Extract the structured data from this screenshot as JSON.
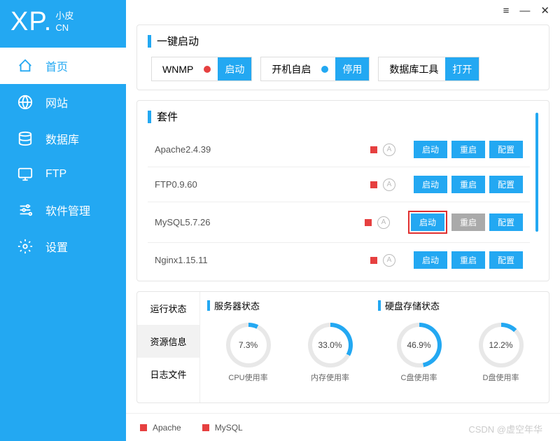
{
  "logo": {
    "main": "XP.",
    "sub1": "小皮",
    "sub2": "CN"
  },
  "nav": [
    {
      "label": "首页",
      "icon": "home",
      "active": true
    },
    {
      "label": "网站",
      "icon": "globe",
      "active": false
    },
    {
      "label": "数据库",
      "icon": "database",
      "active": false
    },
    {
      "label": "FTP",
      "icon": "monitor",
      "active": false
    },
    {
      "label": "软件管理",
      "icon": "sliders",
      "active": false
    },
    {
      "label": "设置",
      "icon": "gear",
      "active": false
    }
  ],
  "titlebar": {
    "menu": "≡",
    "min": "—",
    "close": "✕"
  },
  "quickstart": {
    "title": "一键启动",
    "items": [
      {
        "label": "WNMP",
        "dot": "red",
        "btn": "启动"
      },
      {
        "label": "开机自启",
        "dot": "blue",
        "btn": "停用"
      },
      {
        "label": "数据库工具",
        "dot": "",
        "btn": "打开"
      }
    ]
  },
  "suite": {
    "title": "套件",
    "a_icon": "A",
    "rows": [
      {
        "name": "Apache2.4.39",
        "btns": [
          "启动",
          "重启",
          "配置"
        ],
        "hl": -1,
        "gray": []
      },
      {
        "name": "FTP0.9.60",
        "btns": [
          "启动",
          "重启",
          "配置"
        ],
        "hl": -1,
        "gray": []
      },
      {
        "name": "MySQL5.7.26",
        "btns": [
          "启动",
          "重启",
          "配置"
        ],
        "hl": 0,
        "gray": [
          1
        ]
      },
      {
        "name": "Nginx1.15.11",
        "btns": [
          "启动",
          "重启",
          "配置"
        ],
        "hl": -1,
        "gray": []
      }
    ]
  },
  "status": {
    "tabs": [
      "运行状态",
      "资源信息",
      "日志文件"
    ],
    "active": 1,
    "groups": [
      {
        "title": "服务器状态",
        "gauges": [
          {
            "label": "CPU使用率",
            "val": "7.3%",
            "pct": 7.3
          },
          {
            "label": "内存使用率",
            "val": "33.0%",
            "pct": 33.0
          }
        ]
      },
      {
        "title": "硬盘存储状态",
        "gauges": [
          {
            "label": "C盘使用率",
            "val": "46.9%",
            "pct": 46.9
          },
          {
            "label": "D盘使用率",
            "val": "12.2%",
            "pct": 12.2
          }
        ]
      }
    ]
  },
  "footer": {
    "items": [
      "Apache",
      "MySQL"
    ]
  },
  "watermark": "CSDN @虚空年华",
  "colors": {
    "primary": "#23a8f2",
    "red": "#e64040",
    "gray": "#aaa"
  }
}
